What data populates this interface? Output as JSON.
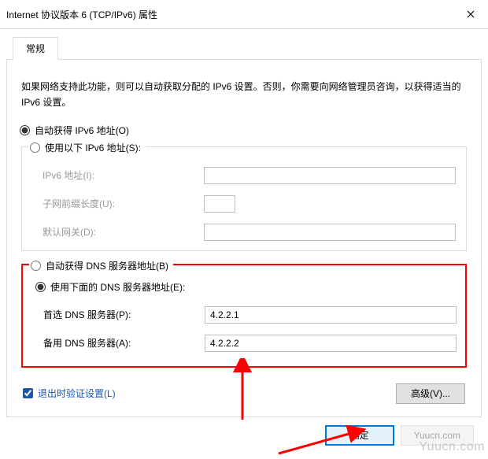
{
  "window": {
    "title": "Internet 协议版本 6 (TCP/IPv6) 属性"
  },
  "tabs": {
    "general": "常规"
  },
  "description": "如果网络支持此功能，则可以自动获取分配的 IPv6 设置。否则，你需要向网络管理员咨询，以获得适当的 IPv6 设置。",
  "ip_section": {
    "auto_label": "自动获得 IPv6 地址(O)",
    "manual_label": "使用以下 IPv6 地址(S):",
    "address_label": "IPv6 地址(I):",
    "prefix_label": "子网前缀长度(U):",
    "gateway_label": "默认网关(D):",
    "address_value": "",
    "prefix_value": "",
    "gateway_value": "",
    "selected": "auto"
  },
  "dns_section": {
    "auto_label": "自动获得 DNS 服务器地址(B)",
    "manual_label": "使用下面的 DNS 服务器地址(E):",
    "preferred_label": "首选 DNS 服务器(P):",
    "alternate_label": "备用 DNS 服务器(A):",
    "preferred_value": "4.2.2.1",
    "alternate_value": "4.2.2.2",
    "selected": "manual"
  },
  "footer": {
    "validate_label": "退出时验证设置(L)",
    "validate_checked": true,
    "advanced_label": "高级(V)...",
    "ok_label": "确定",
    "cancel_label": "Yuucn.com"
  },
  "watermark": "Yuucn.com"
}
